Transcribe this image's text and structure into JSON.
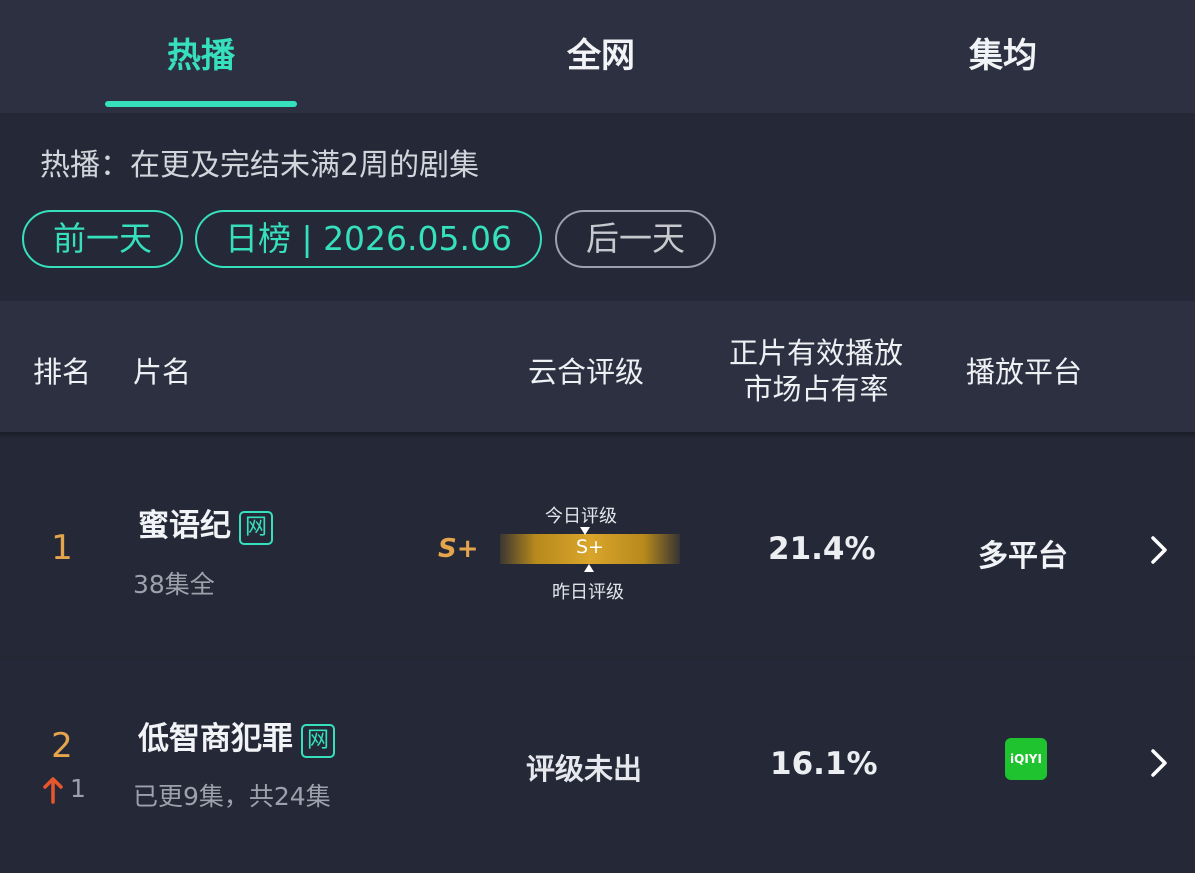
{
  "tabs": [
    {
      "label": "热播",
      "active": true
    },
    {
      "label": "全网",
      "active": false
    },
    {
      "label": "集均",
      "active": false
    }
  ],
  "description": "热播：在更及完结未满2周的剧集",
  "date_nav": {
    "prev_label": "前一天",
    "current_label": "日榜 | 2026.05.06",
    "next_label": "后一天"
  },
  "table_headers": {
    "rank": "排名",
    "name": "片名",
    "rating": "云合评级",
    "share_line1": "正片有效播放",
    "share_line2": "市场占有率",
    "platform": "播放平台"
  },
  "rows": [
    {
      "rank": "1",
      "title": "蜜语纪",
      "badge": "网",
      "episodes": "38集全",
      "rating_left": "S+",
      "rating_today_label": "今日评级",
      "rating_center": "S+",
      "rating_yesterday_label": "昨日评级",
      "share": "21.4%",
      "platform": "多平台"
    },
    {
      "rank": "2",
      "rank_change": "1",
      "title": "低智商犯罪",
      "badge": "网",
      "episodes": "已更9集，共24集",
      "rating": "评级未出",
      "share": "16.1%",
      "platform_logo": "iQIYI"
    }
  ],
  "colors": {
    "accent": "#36e0bd",
    "rank_gold": "#e4a54c",
    "arrow_up": "#e8572b",
    "iqiyi_green": "#1fc22f"
  },
  "icons": [
    "chevron-right-icon",
    "arrow-up-icon",
    "iqiyi-logo"
  ]
}
